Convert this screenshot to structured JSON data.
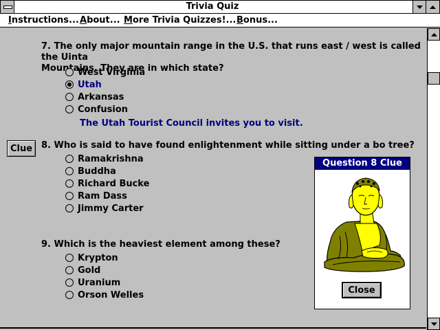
{
  "window": {
    "title": "Trivia Quiz"
  },
  "menu": [
    {
      "label": "Instructions...",
      "accel": "I",
      "rest": "nstructions..."
    },
    {
      "label": "About...",
      "accel": "A",
      "rest": "bout..."
    },
    {
      "label": "More Trivia Quizzes!...",
      "accel": "M",
      "rest": "ore Trivia Quizzes!..."
    },
    {
      "label": "Bonus...",
      "accel": "B",
      "rest": "onus..."
    }
  ],
  "questions": [
    {
      "number_text": "7. The only major mountain range in the U.S. that runs east / west is called the Uinta",
      "line2": "Mountains. They are in which state?",
      "options": [
        "West Virginia",
        "Utah",
        "Arkansas",
        "Confusion"
      ],
      "selected": 1,
      "feedback": "The Utah Tourist Council invites you to visit."
    },
    {
      "number_text": "8. Who is said to have found enlightenment while sitting under a bo tree?",
      "options": [
        "Ramakrishna",
        "Buddha",
        "Richard Bucke",
        "Ram Dass",
        "Jimmy Carter"
      ],
      "selected": -1
    },
    {
      "number_text": "9. Which is the heaviest element among these?",
      "options": [
        "Krypton",
        "Gold",
        "Uranium",
        "Orson Welles"
      ],
      "selected": -1
    }
  ],
  "clue_button": {
    "label": "Clue"
  },
  "clue_dialog": {
    "title": "Question 8 Clue",
    "close_label": "Close",
    "image": "buddha-statue",
    "colors": {
      "robe": "#808000",
      "skin": "#ffff00",
      "title_bg": "#000080"
    }
  }
}
